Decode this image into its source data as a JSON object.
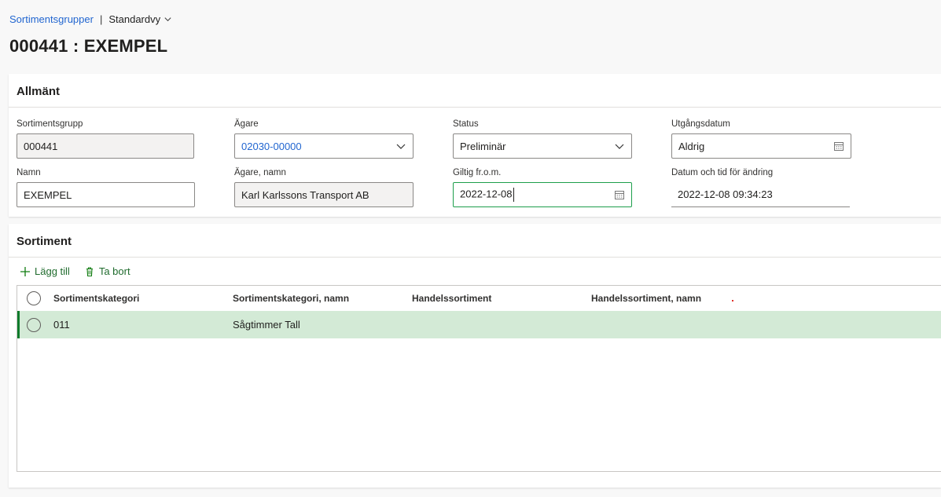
{
  "breadcrumb": {
    "link": "Sortimentsgrupper",
    "separator": "|",
    "view": "Standardvy"
  },
  "page_title": "000441 : EXEMPEL",
  "general": {
    "header": "Allmänt",
    "fields": {
      "group": {
        "label": "Sortimentsgrupp",
        "value": "000441"
      },
      "owner": {
        "label": "Ägare",
        "value": "02030-00000"
      },
      "status": {
        "label": "Status",
        "value": "Preliminär"
      },
      "expiry": {
        "label": "Utgångsdatum",
        "value": "Aldrig"
      },
      "name": {
        "label": "Namn",
        "value": "EXEMPEL"
      },
      "owner_name": {
        "label": "Ägare, namn",
        "value": "Karl Karlssons Transport AB"
      },
      "valid_from": {
        "label": "Giltig fr.o.m.",
        "value": "2022-12-08"
      },
      "modified": {
        "label": "Datum och tid för ändring",
        "value": "2022-12-08 09:34:23"
      }
    }
  },
  "sortiment": {
    "header": "Sortiment",
    "toolbar": {
      "add": "Lägg till",
      "remove": "Ta bort"
    },
    "columns": [
      "Sortimentskategori",
      "Sortimentskategori, namn",
      "Handelssortiment",
      "Handelssortiment, namn"
    ],
    "rows": [
      {
        "category": "011",
        "category_name": "Sågtimmer Tall",
        "trade": "",
        "trade_name": ""
      }
    ]
  },
  "colors": {
    "link": "#2266d0",
    "accent_green": "#107c10",
    "selected_row": "#d3ead6"
  }
}
